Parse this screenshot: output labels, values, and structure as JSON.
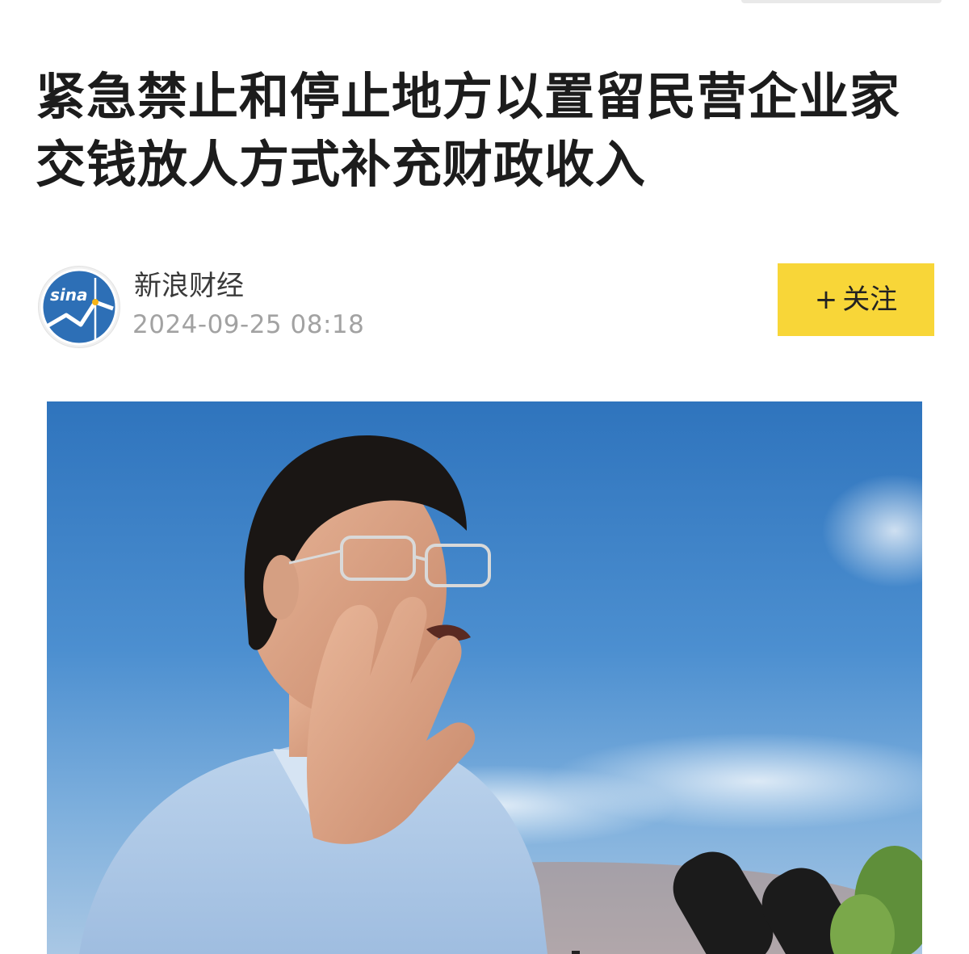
{
  "article": {
    "title": "紧急禁止和停止地方以置留民营企业家交钱放人方式补充财政收入"
  },
  "author": {
    "name": "新浪财经",
    "publish_time": "2024-09-25 08:18",
    "avatar_logo_text": "sina",
    "avatar_icon": "sina-finance-logo-icon"
  },
  "follow": {
    "plus": "+",
    "label": "关注"
  },
  "photo": {
    "subject": "speaker-photo"
  },
  "colors": {
    "follow_button": "#f8d638",
    "title_text": "#1c1c1c",
    "time_text": "#a2a2a2",
    "logo_blue": "#2d6fb6",
    "sky_blue": "#3f86c9"
  }
}
